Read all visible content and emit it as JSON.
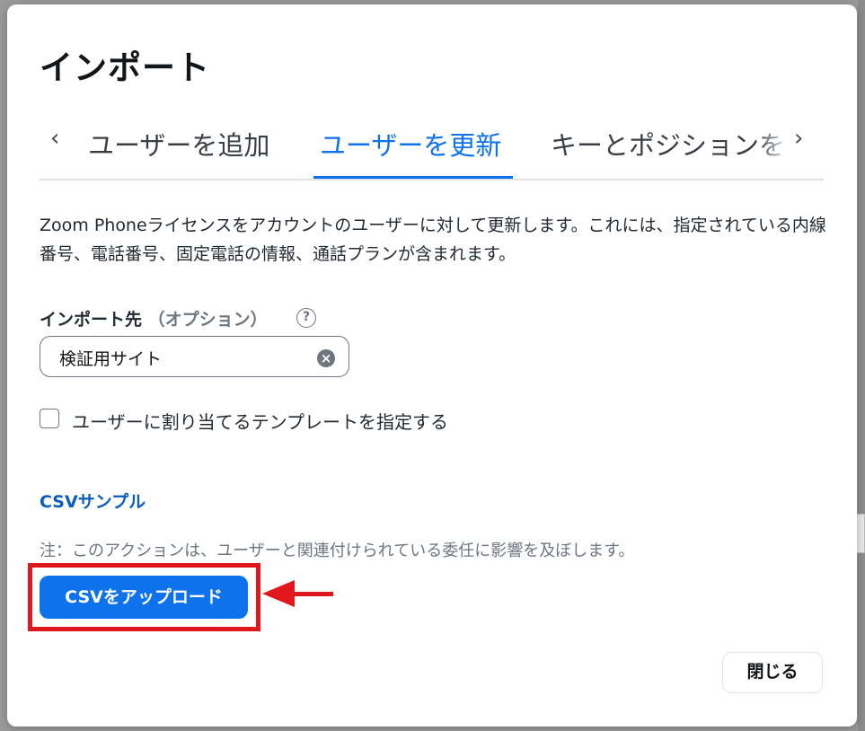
{
  "dialog": {
    "title": "インポート",
    "tabs": [
      {
        "label": "ユーザーを追加",
        "active": false
      },
      {
        "label": "ユーザーを更新",
        "active": true
      },
      {
        "label": "キーとポジションを",
        "active": false
      }
    ],
    "description": "Zoom Phoneライセンスをアカウントのユーザーに対して更新します。これには、指定されている内線番号、電話番号、固定電話の情報、通話プランが含まれます。",
    "import_to": {
      "label": "インポート先",
      "optional_label": "（オプション）",
      "help_icon": "?",
      "value": "検証用サイト",
      "clear_icon": "×"
    },
    "template_checkbox": {
      "label": "ユーザーに割り当てるテンプレートを指定する",
      "checked": false
    },
    "csv_sample_link": "CSVサンプル",
    "note": "注：このアクションは、ユーザーと関連付けられている委任に影響を及ぼします。",
    "upload_button": "CSVをアップロード",
    "close_button": "閉じる"
  },
  "icons": {
    "tab_prev": "‹",
    "tab_next": "›"
  },
  "colors": {
    "accent": "#0e72ed",
    "link": "#0b5cbf",
    "annotation": "#e0181e"
  }
}
